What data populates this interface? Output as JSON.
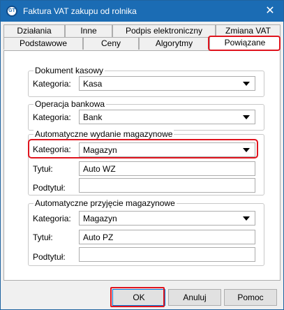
{
  "window": {
    "title": "Faktura VAT zakupu od rolnika",
    "icon": "app-logo-icon",
    "close_glyph": "✕"
  },
  "tabs_row1": [
    "Działania",
    "Inne",
    "Podpis elektroniczny",
    "Zmiana VAT"
  ],
  "tabs_row2": [
    "Podstawowe",
    "Ceny",
    "Algorytmy",
    "Powiązane"
  ],
  "selected_tab": "Powiązane",
  "groups": {
    "dokument_kasowy": {
      "title": "Dokument kasowy",
      "kategoria_label": "Kategoria:",
      "kategoria_value": "Kasa"
    },
    "operacja_bankowa": {
      "title": "Operacja bankowa",
      "kategoria_label": "Kategoria:",
      "kategoria_value": "Bank"
    },
    "wydanie": {
      "title": "Automatyczne wydanie magazynowe",
      "kategoria_label": "Kategoria:",
      "kategoria_value": "Magazyn",
      "tytul_label": "Tytuł:",
      "tytul_value": "Auto WZ",
      "podtytul_label": "Podtytuł:",
      "podtytul_value": ""
    },
    "przyjecie": {
      "title": "Automatyczne przyjęcie magazynowe",
      "kategoria_label": "Kategoria:",
      "kategoria_value": "Magazyn",
      "tytul_label": "Tytuł:",
      "tytul_value": "Auto PZ",
      "podtytul_label": "Podtytuł:",
      "podtytul_value": ""
    }
  },
  "buttons": {
    "ok": "OK",
    "anuluj": "Anuluj",
    "pomoc": "Pomoc"
  },
  "colors": {
    "titlebar": "#1b6cb4",
    "highlight": "#e0141e",
    "ok_border": "#0078d7"
  }
}
